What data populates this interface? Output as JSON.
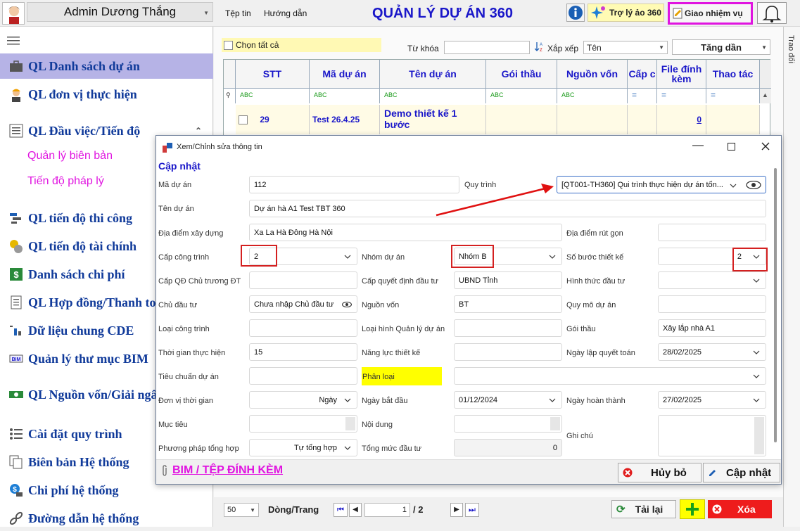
{
  "header": {
    "user_name": "Admin Dương Thắng",
    "menu": [
      "Tệp tin",
      "Hướng dẫn"
    ],
    "app_title": "QUẢN LÝ DỰ ÁN 360",
    "tro_ly_label": "Trợ lý ảo 360",
    "giao_label": "Giao nhiệm vụ"
  },
  "sidebar": {
    "items": [
      {
        "label": "QL Danh sách dự án",
        "icon": "briefcase-icon",
        "active": true
      },
      {
        "label": "QL đơn vị thực hiện",
        "icon": "worker-icon"
      },
      {
        "label": "QL Đầu việc/Tiến độ",
        "icon": "list-icon"
      },
      {
        "label": "QL tiến độ thi công",
        "icon": "gantt-icon"
      },
      {
        "label": "QL tiến độ tài chính",
        "icon": "coins-icon"
      },
      {
        "label": "Danh sách chi phí",
        "icon": "dollar-icon"
      },
      {
        "label": "QL Hợp đồng/Thanh to",
        "icon": "document-icon"
      },
      {
        "label": "Dữ liệu chung CDE",
        "icon": "data-icon"
      },
      {
        "label": "Quản lý thư mục BIM",
        "icon": "bim-icon"
      },
      {
        "label": "QL Nguồn vốn/Giải ngân",
        "icon": "money-icon"
      },
      {
        "label": "Cài đặt quy trình",
        "icon": "process-icon"
      },
      {
        "label": "Biên bản Hệ thống",
        "icon": "copy-icon"
      },
      {
        "label": "Chi phí hệ thống",
        "icon": "cost-icon"
      },
      {
        "label": "Đường dẫn hệ thống",
        "icon": "link-icon"
      }
    ],
    "sub_items": [
      "Quản lý biên bản",
      "Tiến độ pháp lý"
    ]
  },
  "toolbar": {
    "select_all": "Chọn tất cả",
    "keyword_label": "Từ khóa",
    "keyword_value": "",
    "sort_label": "Xắp xếp",
    "sort_field": "Tên",
    "sort_order": "Tăng dần"
  },
  "grid": {
    "columns": [
      "STT",
      "Mã dự án",
      "Tên dự án",
      "Gói thầu",
      "Nguồn vốn",
      "Cấp c",
      "File đính kèm",
      "Thao tác"
    ],
    "filter_placeholder": "ABC",
    "row": {
      "stt": "29",
      "ma": "Test 26.4.25",
      "ten": "Demo thiết kế 1 bước",
      "file": "0"
    }
  },
  "pager": {
    "page_size": "50",
    "rows_label": "Dòng/Trang",
    "page": "1",
    "total": "/ 2",
    "reload": "Tải lại",
    "delete": "Xóa"
  },
  "dialog": {
    "title": "Xem/Chỉnh sửa thông tin",
    "section": "Cập nhật",
    "fields": {
      "ma_du_an": {
        "label": "Mã dự án",
        "value": "112"
      },
      "quy_trinh": {
        "label": "Quy trình",
        "value": "[QT001-TH360] Qui trình thực hiện dự án tổn..."
      },
      "ten_du_an": {
        "label": "Tên dự án",
        "value": "Dự án hà A1 Test TBT 360"
      },
      "dia_diem": {
        "label": "Địa điểm xây dựng",
        "value": "Xa La Hà Đông Hà Nội"
      },
      "dia_diem_rut_gon": {
        "label": "Địa điểm rút gọn",
        "value": ""
      },
      "cap_cong_trinh": {
        "label": "Cấp công trình",
        "value": "2"
      },
      "nhom_du_an": {
        "label": "Nhóm dự án",
        "value": "Nhóm B"
      },
      "so_buoc": {
        "label": "Số bước thiết kế",
        "value": "2"
      },
      "cap_qd_chu_truong": {
        "label": "Cấp QĐ Chủ trương ĐT",
        "value": ""
      },
      "cap_quyet_dinh": {
        "label": "Cấp quyết định đầu tư",
        "value": "UBND Tỉnh"
      },
      "hinh_thuc": {
        "label": "Hình thức đầu tư",
        "value": ""
      },
      "chu_dau_tu": {
        "label": "Chủ đầu tư",
        "value": "Chưa nhập Chủ đầu tư"
      },
      "nguon_von": {
        "label": "Nguồn vốn",
        "value": "BT"
      },
      "quy_mo": {
        "label": "Quy mô dự án",
        "value": ""
      },
      "loai_cong_trinh": {
        "label": "Loại công trình",
        "value": ""
      },
      "loai_hinh_ql": {
        "label": "Loại hình Quản lý dự án",
        "value": ""
      },
      "goi_thau": {
        "label": "Gói thầu",
        "value": "Xây lắp nhà A1"
      },
      "thoi_gian": {
        "label": "Thời gian thực hiện",
        "value": "15"
      },
      "nang_luc": {
        "label": "Năng lực thiết kế",
        "value": ""
      },
      "ngay_lap_qt": {
        "label": "Ngày lập quyết toán",
        "value": "28/02/2025"
      },
      "tieu_chuan": {
        "label": "Tiêu chuẩn dự án",
        "value": ""
      },
      "phan_loai": {
        "label": "Phân loại",
        "value": ""
      },
      "don_vi_tg": {
        "label": "Đơn vị thời gian",
        "value": "Ngày"
      },
      "ngay_bat_dau": {
        "label": "Ngày bắt đầu",
        "value": "01/12/2024"
      },
      "ngay_hoan_thanh": {
        "label": "Ngày hoàn thành",
        "value": "27/02/2025"
      },
      "muc_tieu": {
        "label": "Mục tiêu",
        "value": ""
      },
      "noi_dung": {
        "label": "Nội dung",
        "value": ""
      },
      "ghi_chu": {
        "label": "Ghi chú",
        "value": ""
      },
      "phuong_phap": {
        "label": "Phương pháp tổng hợp",
        "value": "Tự tổng hợp"
      },
      "tong_muc": {
        "label": "Tổng mức đầu tư",
        "value": "0"
      }
    },
    "attach_link": "BIM / TỆP ĐÍNH KÈM",
    "cancel": "Hủy bỏ",
    "update": "Cập nhật"
  },
  "right_strip": "Trao đổi"
}
